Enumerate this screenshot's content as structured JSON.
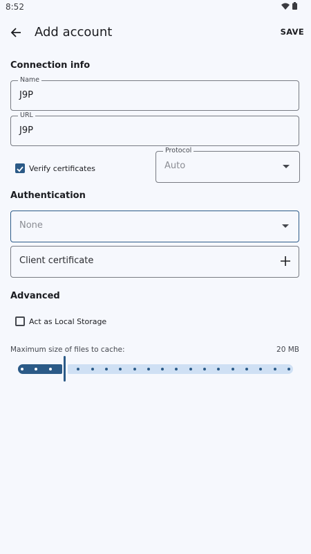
{
  "status_bar": {
    "time": "8:52",
    "icons": [
      "wifi-icon",
      "battery-icon"
    ]
  },
  "app_bar": {
    "title": "Add account",
    "save_label": "SAVE",
    "back_icon": "arrow-back-icon"
  },
  "connection": {
    "section_title": "Connection info",
    "name": {
      "label": "Name",
      "value": "J9P"
    },
    "url": {
      "label": "URL",
      "value": "J9P"
    },
    "verify_certificates": {
      "label": "Verify certificates",
      "checked": true
    },
    "protocol": {
      "label": "Protocol",
      "value": "Auto"
    }
  },
  "authentication": {
    "section_title": "Authentication",
    "method": {
      "value": "None"
    },
    "client_certificate": {
      "label": "Client certificate"
    }
  },
  "advanced": {
    "section_title": "Advanced",
    "local_storage": {
      "label": "Act as Local Storage",
      "checked": false
    },
    "cache": {
      "caption": "Maximum size of files to cache:",
      "value_text": "20 MB",
      "level_fraction": 0.16,
      "steps": 20
    }
  },
  "colors": {
    "accent": "#2b5a87",
    "track_inactive": "#cfe0f4",
    "background": "#f6f8fd"
  }
}
